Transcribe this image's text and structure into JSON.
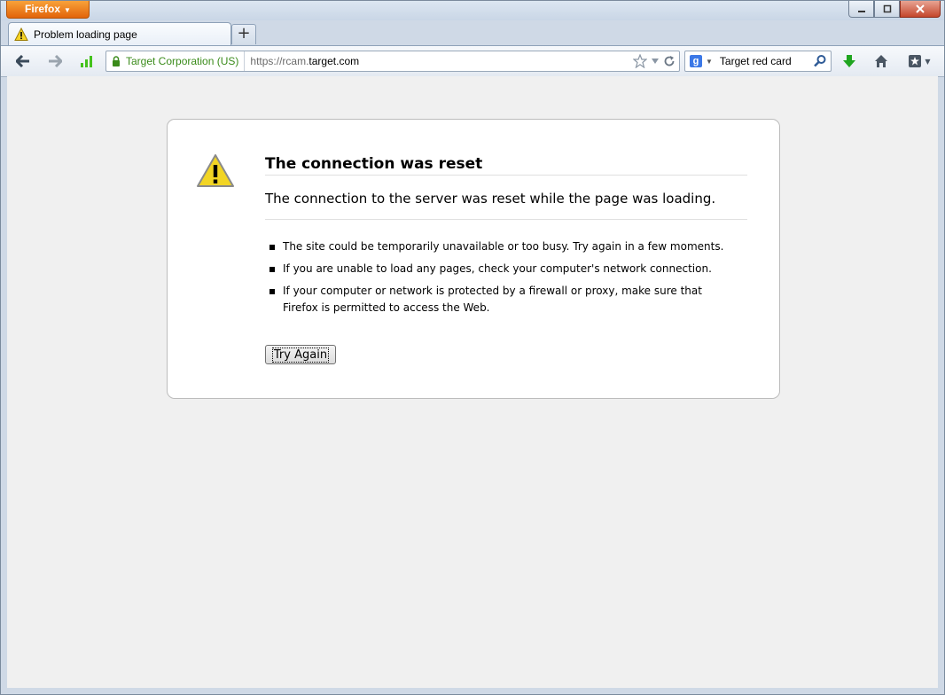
{
  "app": {
    "menu_label": "Firefox"
  },
  "tab": {
    "title": "Problem loading page"
  },
  "navbar": {
    "identity_label": "Target Corporation (US)",
    "url_prefix": "https://rcam.",
    "url_domain": "target.com",
    "search_engine_letter": "g",
    "search_value": "Target red card"
  },
  "error": {
    "title": "The connection was reset",
    "short_desc": "The connection to the server was reset while the page was loading.",
    "items": [
      "The site could be temporarily unavailable or too busy. Try again in a few moments.",
      "If you are unable to load any pages, check your computer's network connection.",
      "If your computer or network is protected by a firewall or proxy, make sure that Firefox is permitted to access the Web."
    ],
    "button_label": "Try Again"
  }
}
